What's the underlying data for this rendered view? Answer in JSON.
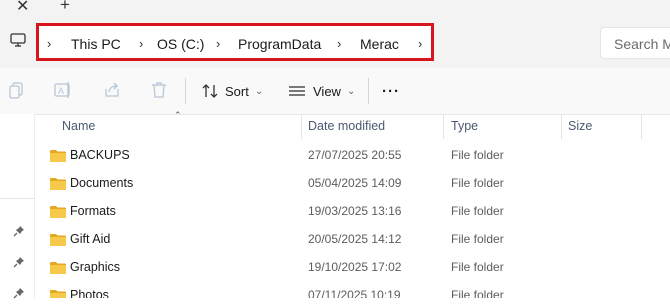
{
  "tabbar": {
    "close_glyph": "✕",
    "new_tab_glyph": "+"
  },
  "address_bar": {
    "separator_glyph": "›",
    "segments": [
      "This PC",
      "OS (C:)",
      "ProgramData",
      "Merac"
    ],
    "highlight_color": "#d8141c"
  },
  "search": {
    "placeholder": "Search M"
  },
  "toolbar": {
    "sort_label": "Sort",
    "view_label": "View",
    "more_label": "···",
    "dropdown_glyph": "⌄",
    "icons": [
      "copy-icon",
      "rename-icon",
      "share-icon",
      "delete-icon",
      "sort-icon",
      "view-icon"
    ]
  },
  "columns": {
    "name": "Name",
    "date": "Date modified",
    "type": "Type",
    "size": "Size",
    "sort_glyph": "⌃"
  },
  "files": [
    {
      "name": "BACKUPS",
      "date": "27/07/2025 20:55",
      "type": "File folder"
    },
    {
      "name": "Documents",
      "date": "05/04/2025 14:09",
      "type": "File folder"
    },
    {
      "name": "Formats",
      "date": "19/03/2025 13:16",
      "type": "File folder"
    },
    {
      "name": "Gift Aid",
      "date": "20/05/2025 14:12",
      "type": "File folder"
    },
    {
      "name": "Graphics",
      "date": "19/10/2025 17:02",
      "type": "File folder"
    },
    {
      "name": "Photos",
      "date": "07/11/2025 10:19",
      "type": "File folder"
    }
  ],
  "colors": {
    "folder": "#f7c948",
    "folder_dark": "#e3a923",
    "accent": "#0067c0"
  }
}
